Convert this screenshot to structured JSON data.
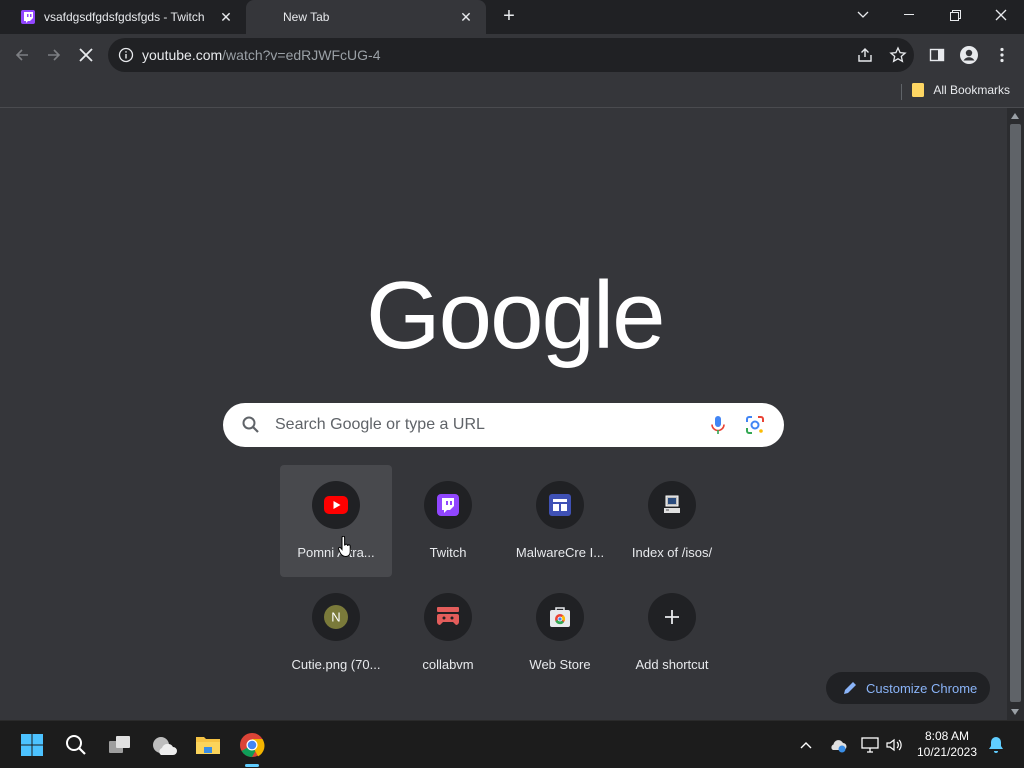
{
  "tabs": [
    {
      "title": "vsafdgsdfgdsfgdsfgds - Twitch",
      "active": false
    },
    {
      "title": "New Tab",
      "active": true
    }
  ],
  "omnibox": {
    "domain": "youtube.com",
    "path": "/watch?v=edRJWFcUG-4"
  },
  "bookmarks": {
    "all_label": "All Bookmarks"
  },
  "ntp": {
    "logo_text": "Google",
    "search_placeholder": "Search Google or type a URL",
    "shortcuts": [
      {
        "label": "Pomni A tra...",
        "icon": "youtube-icon"
      },
      {
        "label": "Twitch",
        "icon": "twitch-icon"
      },
      {
        "label": "MalwareCre I...",
        "icon": "malwarecre-icon"
      },
      {
        "label": "Index of /isos/",
        "icon": "computer-icon"
      },
      {
        "label": "Cutie.png (70...",
        "icon": "letter-n-icon",
        "letter": "N"
      },
      {
        "label": "collabvm",
        "icon": "collabvm-icon"
      },
      {
        "label": "Web Store",
        "icon": "web-store-icon"
      },
      {
        "label": "Add shortcut",
        "icon": "plus-icon"
      }
    ],
    "customize_label": "Customize Chrome"
  },
  "taskbar": {
    "time": "8:08 AM",
    "date": "10/21/2023"
  },
  "colors": {
    "accent": "#8ab4f8",
    "twitch": "#9146ff",
    "youtube": "#ff0000",
    "bg": "#35363a"
  }
}
